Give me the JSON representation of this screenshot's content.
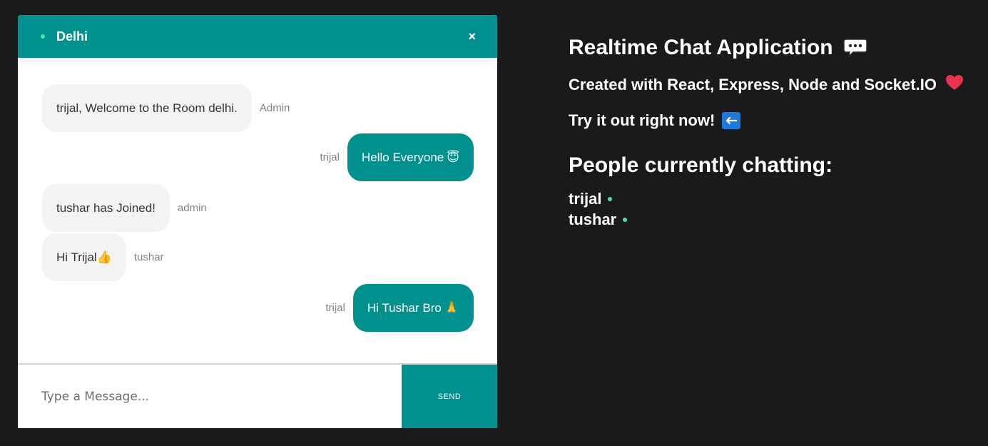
{
  "chat": {
    "room_name": "Delhi",
    "close_label": "×",
    "messages": [
      {
        "text": "trijal, Welcome to the Room delhi.",
        "sender": "Admin",
        "emoji": ""
      },
      {
        "text": "Hello Everyone",
        "sender": "trijal",
        "emoji": "😇"
      },
      {
        "text": "tushar has Joined!",
        "sender": "admin",
        "emoji": ""
      },
      {
        "text": "Hi Trijal",
        "sender": "tushar",
        "emoji": "👍"
      },
      {
        "text": "Hi Tushar Bro",
        "sender": "trijal",
        "emoji": "🙏"
      }
    ],
    "input_placeholder": "Type a Message...",
    "send_label": "SEND"
  },
  "info": {
    "title": "Realtime Chat Application",
    "subtitle": "Created with React, Express, Node and Socket.IO",
    "try_text": "Try it out right now!",
    "people_heading": "People currently chatting:",
    "users": [
      "trijal",
      "tushar"
    ]
  },
  "colors": {
    "accent": "#00918e",
    "background": "#1a1a1d",
    "online": "#4ee6a5",
    "heart": "#e8344e",
    "arrow_box": "#1e7ad9"
  },
  "icons": {
    "title_icon": "speech-balloon-icon",
    "subtitle_icon": "red-heart-icon",
    "try_icon": "left-arrow-icon"
  }
}
